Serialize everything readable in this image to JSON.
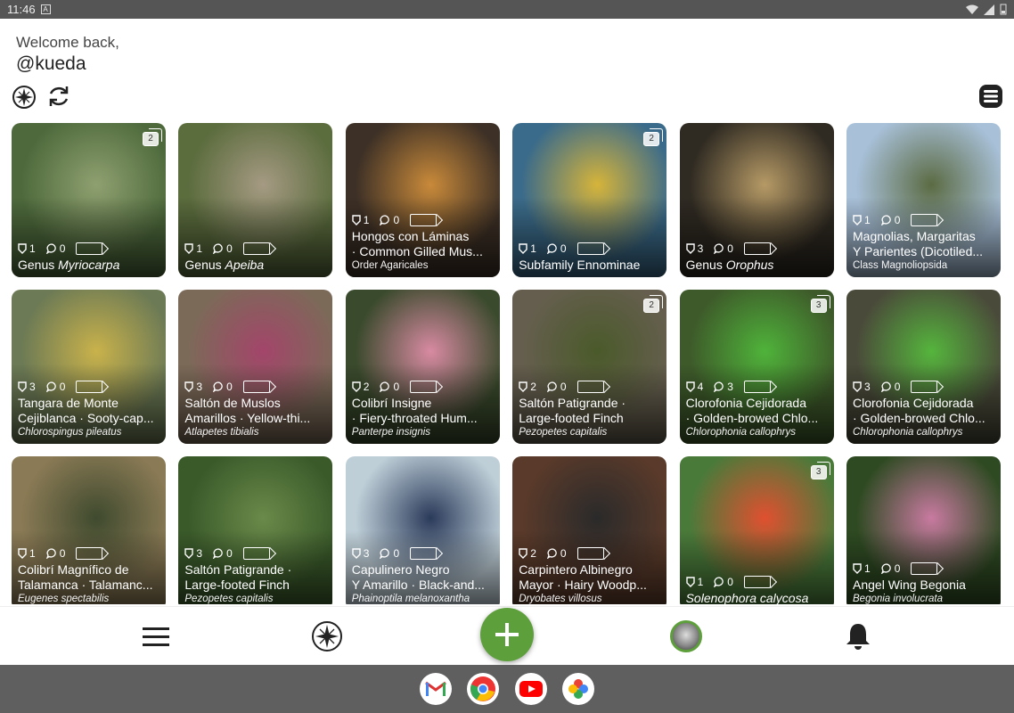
{
  "status": {
    "time": "11:46",
    "notif": "A"
  },
  "header": {
    "welcome": "Welcome back,",
    "username": "@kueda"
  },
  "icons": {
    "explore": "compass-icon",
    "sync": "sync-icon",
    "layout": "list-layout-icon"
  },
  "observations": [
    {
      "bg": "#4e6a3c",
      "bg2": "#8fa070",
      "count": "2",
      "stats": [
        "1",
        "0"
      ],
      "id": "add",
      "t1": "Genus ",
      "t1i": "Myriocarpa",
      "t2": "",
      "sub": "",
      "subItalic": false
    },
    {
      "bg": "#5b6c3d",
      "bg2": "#a59a83",
      "count": "",
      "stats": [
        "1",
        "0"
      ],
      "id": "add",
      "t1": "Genus ",
      "t1i": "Apeiba",
      "t2": "",
      "sub": "",
      "subItalic": false
    },
    {
      "bg": "#3d3026",
      "bg2": "#c98a3a",
      "count": "",
      "stats": [
        "1",
        "0"
      ],
      "id": "add",
      "t1": "Hongos con Láminas",
      "t1i": "",
      "t2": "· Common Gilled Mus...",
      "sub": "Order Agaricales",
      "subItalic": false
    },
    {
      "bg": "#3b6b8a",
      "bg2": "#d6b43a",
      "count": "2",
      "stats": [
        "1",
        "0"
      ],
      "id": "add",
      "t1": "Subfamily Ennominae",
      "t1i": "",
      "t2": "",
      "sub": "",
      "subItalic": false
    },
    {
      "bg": "#2f2a22",
      "bg2": "#b69a66",
      "count": "",
      "stats": [
        "3",
        "0"
      ],
      "id": "add",
      "t1": "Genus ",
      "t1i": "Orophus",
      "t2": "",
      "sub": "",
      "subItalic": false
    },
    {
      "bg": "#a8c0d8",
      "bg2": "#5b6b43",
      "count": "",
      "stats": [
        "1",
        "0"
      ],
      "id": "add",
      "t1": "Magnolias, Margaritas",
      "t1i": "",
      "t2": "Y Parientes (Dicotiled...",
      "sub": "Class Magnoliopsida",
      "subItalic": false
    },
    {
      "bg": "#6c7a55",
      "bg2": "#c9b24b",
      "count": "",
      "stats": [
        "3",
        "0"
      ],
      "id": "agree",
      "t1": "Tangara de Monte",
      "t1i": "",
      "t2": "Cejiblanca · Sooty-cap...",
      "sub": "Chlorospingus pileatus",
      "subItalic": true
    },
    {
      "bg": "#7c6a58",
      "bg2": "#a3456a",
      "count": "",
      "stats": [
        "3",
        "0"
      ],
      "id": "agree",
      "t1": "Saltón de Muslos",
      "t1i": "",
      "t2": "Amarillos · Yellow-thi...",
      "sub": "Atlapetes tibialis",
      "subItalic": true
    },
    {
      "bg": "#3a4a2c",
      "bg2": "#d88aa2",
      "count": "",
      "stats": [
        "2",
        "0"
      ],
      "id": "agree",
      "t1": "Colibrí Insigne",
      "t1i": "",
      "t2": "· Fiery-throated Hum...",
      "sub": "Panterpe insignis",
      "subItalic": true
    },
    {
      "bg": "#655e4e",
      "bg2": "#4a5a2a",
      "count": "2",
      "stats": [
        "2",
        "0"
      ],
      "id": "agree",
      "t1": "Saltón Patigrande ·",
      "t1i": "",
      "t2": "Large-footed Finch",
      "sub": "Pezopetes capitalis",
      "subItalic": true
    },
    {
      "bg": "#3e5a2a",
      "bg2": "#4fb33a",
      "count": "3",
      "stats": [
        "4",
        "3"
      ],
      "id": "agree",
      "t1": "Clorofonia Cejidorada",
      "t1i": "",
      "t2": "· Golden-browed Chlo...",
      "sub": "Chlorophonia callophrys",
      "subItalic": true
    },
    {
      "bg": "#4a4a3a",
      "bg2": "#55b53c",
      "count": "",
      "stats": [
        "3",
        "0"
      ],
      "id": "agree",
      "t1": "Clorofonia Cejidorada",
      "t1i": "",
      "t2": "· Golden-browed Chlo...",
      "sub": "Chlorophonia callophrys",
      "subItalic": true
    },
    {
      "bg": "#8a7a55",
      "bg2": "#3f4a2e",
      "count": "",
      "stats": [
        "1",
        "0"
      ],
      "id": "add",
      "t1": "Colibrí Magnífico de",
      "t1i": "",
      "t2": "Talamanca · Talamanc...",
      "sub": "Eugenes spectabilis",
      "subItalic": true
    },
    {
      "bg": "#3a5a2a",
      "bg2": "#6a8a4a",
      "count": "",
      "stats": [
        "3",
        "0"
      ],
      "id": "agree",
      "t1": "Saltón Patigrande ·",
      "t1i": "",
      "t2": "Large-footed Finch",
      "sub": "Pezopetes capitalis",
      "subItalic": true
    },
    {
      "bg": "#bfcfd8",
      "bg2": "#2a3a5a",
      "count": "",
      "stats": [
        "3",
        "0"
      ],
      "id": "agree",
      "t1": "Capulinero Negro",
      "t1i": "",
      "t2": "Y Amarillo · Black-and...",
      "sub": "Phainoptila melanoxantha",
      "subItalic": true
    },
    {
      "bg": "#5a3a2a",
      "bg2": "#2a2a2a",
      "count": "",
      "stats": [
        "2",
        "0"
      ],
      "id": "agree",
      "t1": "Carpintero Albinegro",
      "t1i": "",
      "t2": "Mayor · Hairy Woodp...",
      "sub": "Dryobates villosus",
      "subItalic": true
    },
    {
      "bg": "#4a7a3a",
      "bg2": "#e05030",
      "count": "3",
      "stats": [
        "1",
        "0"
      ],
      "id": "add",
      "t1": "Solenophora calycosa",
      "t1i": "",
      "t2": "",
      "sub": "",
      "subItalic": false,
      "t1Italic": true
    },
    {
      "bg": "#2e4a22",
      "bg2": "#c87aa0",
      "count": "",
      "stats": [
        "1",
        "0"
      ],
      "id": "add",
      "t1": "Angel Wing Begonia",
      "t1i": "",
      "t2": "",
      "sub": "Begonia involucrata",
      "subItalic": true
    }
  ],
  "nav": {
    "menu": "hamburger-menu-icon",
    "explore": "compass-icon",
    "add": "plus-icon",
    "profile": "avatar",
    "notifications": "bell-icon"
  },
  "taskbar": {
    "apps": [
      "Gmail",
      "Chrome",
      "YouTube",
      "Photos"
    ]
  }
}
